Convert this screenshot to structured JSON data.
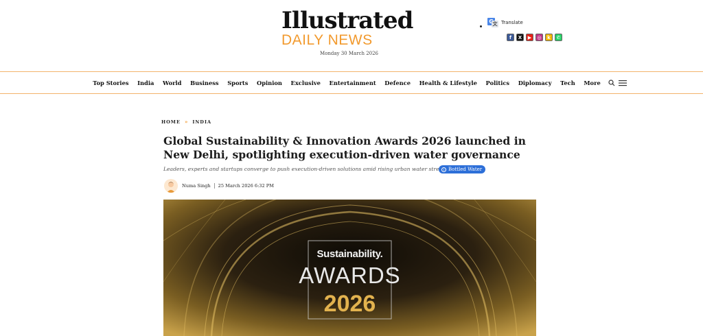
{
  "masthead": {
    "logo_top": "Illustrated",
    "logo_bottom": "DAILY NEWS",
    "date": "Monday 30 March 2026",
    "translate_label": "Translate",
    "socials": [
      {
        "icon": "facebook-icon",
        "color": "#3b5998",
        "glyph": "f"
      },
      {
        "icon": "x-icon",
        "color": "#111111",
        "glyph": "X"
      },
      {
        "icon": "youtube-icon",
        "color": "#e62117",
        "glyph": "▶"
      },
      {
        "icon": "instagram-icon",
        "color": "#c13584",
        "glyph": "◎"
      },
      {
        "icon": "koo-icon",
        "color": "#f5b800",
        "glyph": "k"
      },
      {
        "icon": "whatsapp-icon",
        "color": "#25d366",
        "glyph": "✆"
      }
    ]
  },
  "nav": {
    "items": [
      "Top Stories",
      "India",
      "World",
      "Business",
      "Sports",
      "Opinion",
      "Exclusive",
      "Entertainment",
      "Defence",
      "Health & Lifestyle",
      "Politics",
      "Diplomacy",
      "Tech",
      "More"
    ]
  },
  "breadcrumb": {
    "home": "HOME",
    "separator": "»",
    "section": "INDIA"
  },
  "article": {
    "headline": "Global Sustainability & Innovation Awards 2026 launched in New Delhi, spotlighting execution-driven water governance",
    "subheadline": "Leaders, experts and startups converge to push execution-driven solutions amid rising urban water stress",
    "tag": "Bottled Water",
    "author": "Numa Singh",
    "published": "25 March 2026 6:32 PM"
  },
  "hero": {
    "line1": "Sustainability.",
    "line2": "AWARDS",
    "line3": "2026"
  },
  "colors": {
    "accent": "#f29a2e",
    "tag_blue": "#2d6fd8",
    "gold": "#e2b24e"
  }
}
